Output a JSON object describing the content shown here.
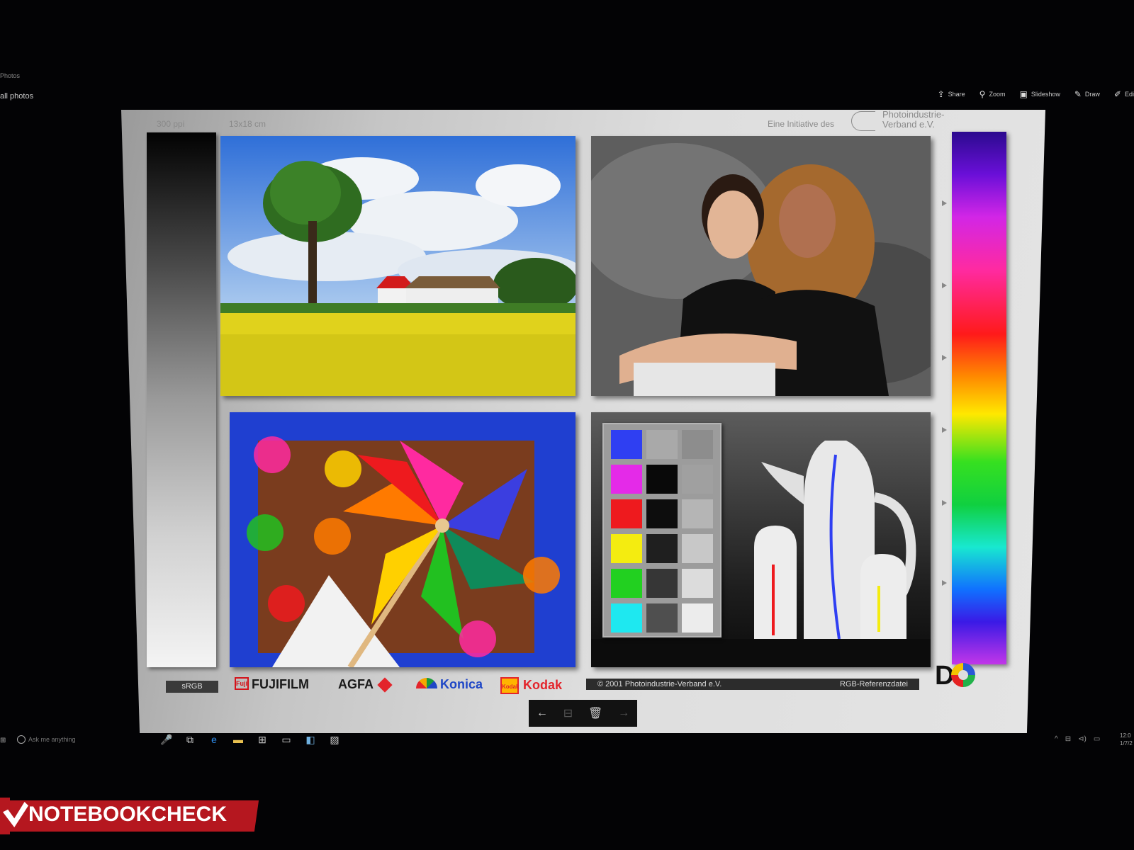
{
  "app": {
    "title": "Photos",
    "back_label": "all photos"
  },
  "toolbar": [
    {
      "icon": "share-icon",
      "glyph": "⇪",
      "label": "Share"
    },
    {
      "icon": "zoom-icon",
      "glyph": "⚲",
      "label": "Zoom"
    },
    {
      "icon": "slideshow-icon",
      "glyph": "▣",
      "label": "Slideshow"
    },
    {
      "icon": "draw-icon",
      "glyph": "✎",
      "label": "Draw"
    },
    {
      "icon": "edit-icon",
      "glyph": "✐",
      "label": "Edi"
    }
  ],
  "chart": {
    "resolution": "300 ppi",
    "print_size": "13x18 cm",
    "initiative": "Eine Initiative des",
    "org_line1": "Photoindustrie-",
    "org_line2": "Verband e.V.",
    "srgb": "sRGB",
    "brands": {
      "fujifilm": "FUJIFILM",
      "fuji_mark": "Fuji",
      "agfa": "AGFA",
      "konica": "Konica",
      "kodak": "Kodak",
      "kodak_mark": "Kodak"
    },
    "copyright": "© 2001  Photoindustrie-Verband e.V.",
    "ref_file": "RGB-Referenzdatei",
    "dq_logo": "D",
    "color_patches": [
      "#2f3ff2",
      "#e42ae8",
      "#ee1a1e",
      "#f4ec10",
      "#22d020",
      "#1ee8f0"
    ],
    "mid_patches": [
      "#a9a9a9",
      "#090909",
      "#0d0d0d",
      "#1f1f1f",
      "#363636",
      "#4f4f4f"
    ],
    "light_patches": [
      "#8d8d8d",
      "#a0a0a0",
      "#b5b5b5",
      "#c8c8c8",
      "#dcdcdc",
      "#ececec"
    ]
  },
  "nav": {
    "prev": "←",
    "info": "⊟",
    "delete": "🗑",
    "next": "→"
  },
  "taskbar": {
    "start": "⊞",
    "search_placeholder": "Ask me anything",
    "mic": "🎤",
    "taskview": "⧉",
    "apps": [
      {
        "icon": "edge-icon",
        "glyph": "e",
        "color": "#2f8ff0"
      },
      {
        "icon": "explorer-icon",
        "glyph": "▬",
        "color": "#e8c050"
      },
      {
        "icon": "store-icon",
        "glyph": "⊞",
        "color": "#cfcfcf"
      },
      {
        "icon": "app-window-icon",
        "glyph": "▭",
        "color": "#cfcfcf"
      },
      {
        "icon": "app-tile-icon",
        "glyph": "◧",
        "color": "#6fb0e0"
      },
      {
        "icon": "photos-icon",
        "glyph": "▨",
        "color": "#cfcfcf"
      }
    ],
    "tray": [
      "^",
      "⊟",
      "⊲)",
      "▭"
    ],
    "clock_time": "12:0",
    "clock_date": "1/7/2"
  },
  "watermark": {
    "text": "NOTEBOOKCHECK"
  }
}
